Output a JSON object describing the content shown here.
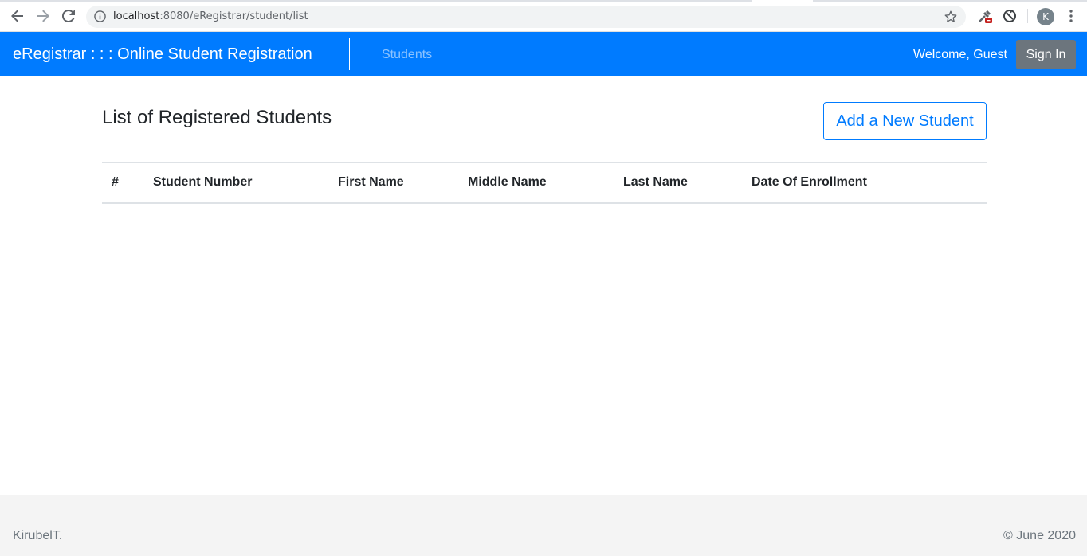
{
  "browser": {
    "url_host": "localhost",
    "url_path": ":8080/eRegistrar/student/list",
    "profile_initial": "K",
    "icons": [
      "back-icon",
      "forward-icon",
      "reload-icon",
      "info-icon",
      "star-icon",
      "eyedropper-extension-icon",
      "sync-extension-icon",
      "menu-icon"
    ]
  },
  "navbar": {
    "brand": "eRegistrar : : : Online Student Registration",
    "links": [
      "Students"
    ],
    "welcome": "Welcome, Guest",
    "signin_label": "Sign In",
    "bg_color": "#007bff"
  },
  "main": {
    "title": "List of Registered Students",
    "add_button_label": "Add a New Student",
    "table": {
      "columns": [
        "#",
        "Student Number",
        "First Name",
        "Middle Name",
        "Last Name",
        "Date Of Enrollment"
      ],
      "rows": []
    }
  },
  "footer": {
    "left": "KirubelT.",
    "right": "© June 2020"
  }
}
